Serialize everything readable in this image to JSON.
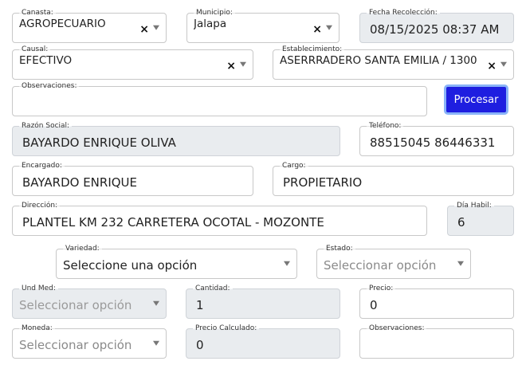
{
  "canasta": {
    "label": "Canasta:",
    "value": "AGROPECUARIO"
  },
  "municipio": {
    "label": "Municipio:",
    "value": "Jalapa"
  },
  "fecha": {
    "label": "Fecha Recolección:",
    "value": "08/15/2025 08:37 AM"
  },
  "causal": {
    "label": "Causal:",
    "value": "EFECTIVO"
  },
  "establecimiento": {
    "label": "Establecimiento:",
    "value": "ASERRRADERO SANTA EMILIA / 1300"
  },
  "observaciones_top": {
    "label": "Observaciones:",
    "value": ""
  },
  "procesar_button": "Procesar",
  "razon_social": {
    "label": "Razón Social:",
    "value": "BAYARDO ENRIQUE  OLIVA"
  },
  "telefono": {
    "label": "Teléfono:",
    "value": "88515045 86446331"
  },
  "encargado": {
    "label": "Encargado:",
    "value": "BAYARDO  ENRIQUE"
  },
  "cargo": {
    "label": "Cargo:",
    "value": "PROPIETARIO"
  },
  "direccion": {
    "label": "Dirección:",
    "value": "PLANTEL KM 232 CARRETERA OCOTAL - MOZONTE"
  },
  "dia_habil": {
    "label": "Día Habil:",
    "value": "6"
  },
  "variedad": {
    "label": "Variedad:",
    "value": "Seleccione una opción"
  },
  "estado": {
    "label": "Estado:",
    "placeholder": "Seleccionar opción"
  },
  "und_med": {
    "label": "Und Med:",
    "placeholder": "Seleccionar opción"
  },
  "cantidad": {
    "label": "Cantidad:",
    "value": "1"
  },
  "precio": {
    "label": "Precio:",
    "value": "0"
  },
  "moneda": {
    "label": "Moneda:",
    "placeholder": "Seleccionar opción"
  },
  "precio_calculado": {
    "label": "Precio Calculado:",
    "value": "0"
  },
  "observaciones_bottom": {
    "label": "Observaciones:",
    "value": ""
  },
  "icons": {
    "clear": "clear-x-icon",
    "caret": "chevron-down-icon"
  }
}
